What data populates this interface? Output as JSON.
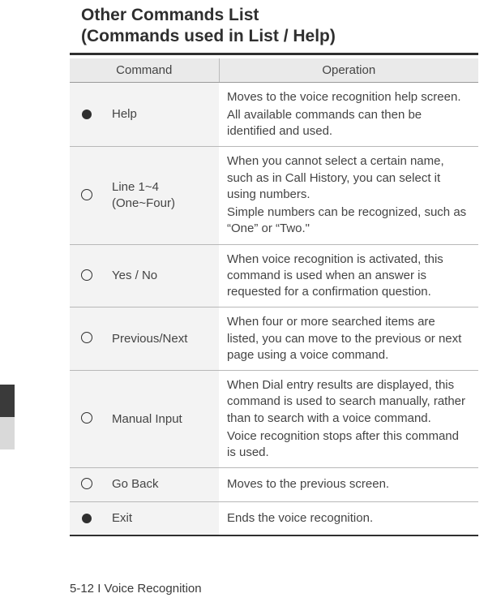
{
  "heading": {
    "line1": "Other Commands List",
    "line2": "(Commands used in List / Help)"
  },
  "table": {
    "headers": {
      "command": "Command",
      "operation": "Operation"
    },
    "rows": [
      {
        "marker": "filled",
        "command": "Help",
        "command_sub": "",
        "operation": "Moves to the voice recognition help screen.\nAll available commands can then be identified and used."
      },
      {
        "marker": "hollow",
        "command": "Line 1~4",
        "command_sub": "(One~Four)",
        "operation": "When you cannot select a certain name, such as in Call History, you can select it using numbers.\nSimple numbers can be recognized, such as “One” or “Two.\""
      },
      {
        "marker": "hollow",
        "command": "Yes / No",
        "command_sub": "",
        "operation": "When voice recognition is activated, this command is used when an answer is requested for a confirmation question."
      },
      {
        "marker": "hollow",
        "command": "Previous/Next",
        "command_sub": "",
        "operation": "When four or more searched items are listed, you can move to the previous or next page using a voice command."
      },
      {
        "marker": "hollow",
        "command": "Manual Input",
        "command_sub": "",
        "operation": "When Dial entry results are displayed, this command is used to search manually, rather than to search with a voice command.\nVoice recognition stops after this command is used."
      },
      {
        "marker": "hollow",
        "command": "Go Back",
        "command_sub": "",
        "operation": "Moves to the previous screen."
      },
      {
        "marker": "filled",
        "command": "Exit",
        "command_sub": "",
        "operation": "Ends the voice recognition."
      }
    ]
  },
  "footer": "5-12 I Voice Recognition"
}
